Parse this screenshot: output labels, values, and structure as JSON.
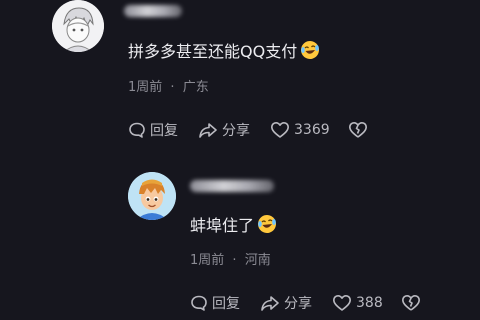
{
  "comments": [
    {
      "text": "拼多多甚至还能QQ支付",
      "emoji": "laughing-crying-emoji",
      "time": "1周前",
      "location": "广东",
      "reply_label": "回复",
      "share_label": "分享",
      "like_count": "3369"
    },
    {
      "text": "蚌埠住了",
      "emoji": "laughing-crying-emoji",
      "time": "1周前",
      "location": "河南",
      "reply_label": "回复",
      "share_label": "分享",
      "like_count": "388"
    }
  ],
  "separator": "·",
  "colors": {
    "background": "#16161e",
    "text": "#ececf0",
    "meta": "#8b8b94",
    "action": "#b9b9c0"
  }
}
